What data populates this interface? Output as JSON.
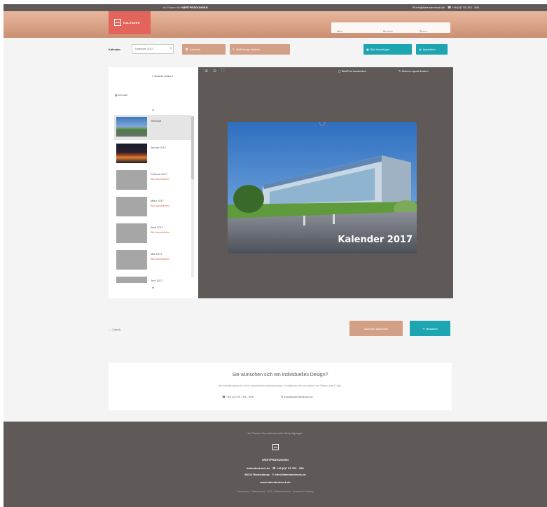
{
  "topbar": {
    "promo_prefix": "Ihr Partner für",
    "promo_brand": "WERTPRÄGUNGEN",
    "email": "info@kalenderdruck.de",
    "phone": "+49 (0)7 51 763 - 398"
  },
  "header": {
    "brand_name": "KALENDER",
    "nav_left": "Mein Konto",
    "nav_middle": "Kontakt",
    "nav_right": "Suche"
  },
  "toolbar": {
    "calendar_label": "Kalender",
    "calendar_select_value": "Kalender 2017",
    "btn_delete": "Löschen",
    "btn_change_design": "Bild/Design ändern",
    "btn_add_element": "Bild hinzufügen",
    "btn_save": "Speichern"
  },
  "sidebar": {
    "view_toggle": "Ansicht ändern",
    "month_list_label": "Monate",
    "items": [
      {
        "title": "Titelblatt",
        "status": ""
      },
      {
        "title": "Januar 2017",
        "status": ""
      },
      {
        "title": "Februar 2017",
        "status": "Bild auswählen"
      },
      {
        "title": "März 2017",
        "status": "Bild auswählen"
      },
      {
        "title": "April 2017",
        "status": "Bild auswählen"
      },
      {
        "title": "Mai 2017",
        "status": "Bild auswählen"
      },
      {
        "title": "Juni 2017",
        "status": ""
      }
    ]
  },
  "viewer": {
    "tool_text": "Bild/Text bearbeiten",
    "tool_layout": "Seiten-Layout ändern",
    "page_caption": "Kalender 2017"
  },
  "actions": {
    "back": "Zurück",
    "preview": "Kalender speichern",
    "continue": "Bestellen"
  },
  "info_card": {
    "title": "Sie wünschen sich ein individuelles Design?",
    "description": "Wir erstellen gerne für Sie Ihr persönliches Kalenderdesign. Kontaktieren Sie uns einfach per Telefon oder E-Mail.",
    "phone": "+49 (0)7 51 763 - 398",
    "email": "info@kalenderdruck.de"
  },
  "footer": {
    "tagline": "Ihr Partner für professionelle Wertprägungen",
    "brand": "WERTPRÄGUNGEN",
    "site": "kalenderdruck.de",
    "phone": "+49 (0)7 51 763 - 398",
    "city": "88212 Ravensburg",
    "email": "info@kalenderdruck.de",
    "link": "www.kalenderdruck.de",
    "legal": "Impressum · Datenschutz · AGB · Widerrufsrecht · Versand & Zahlung"
  },
  "colors": {
    "accent_tan": "#d39f86",
    "accent_teal": "#1ea5b2",
    "logo_red": "#e2645a",
    "dark_panel": "#5f5a58"
  }
}
